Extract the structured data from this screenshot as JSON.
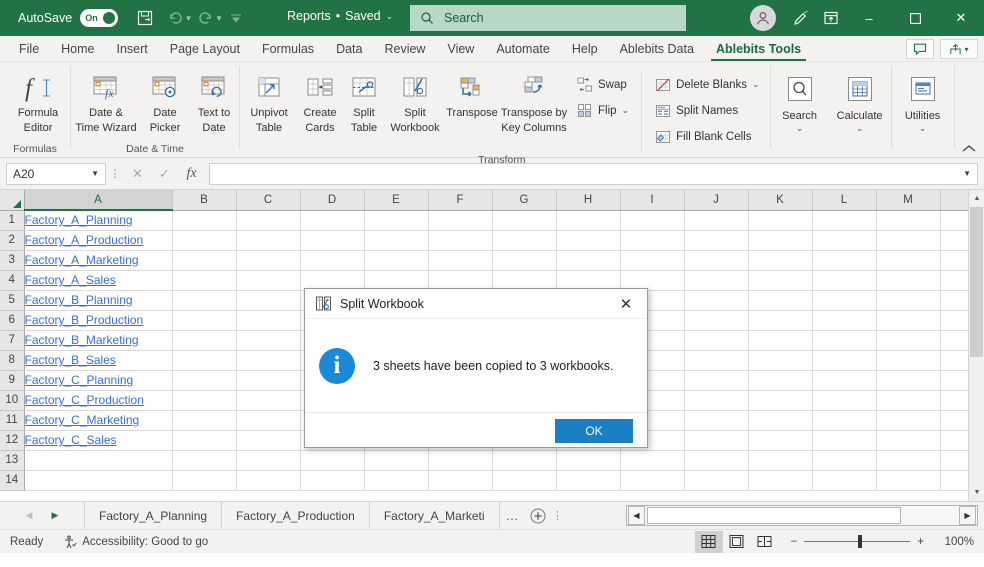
{
  "titlebar": {
    "autosave_label": "AutoSave",
    "autosave_state": "On",
    "doc_title": "Reports",
    "doc_sep": "•",
    "doc_status": "Saved",
    "search_placeholder": "Search",
    "minimize": "–",
    "maximize": "▢",
    "close": "✕",
    "accent": "#217346"
  },
  "ribbon_tabs": [
    {
      "label": "File",
      "active": false
    },
    {
      "label": "Home",
      "active": false
    },
    {
      "label": "Insert",
      "active": false
    },
    {
      "label": "Page Layout",
      "active": false
    },
    {
      "label": "Formulas",
      "active": false
    },
    {
      "label": "Data",
      "active": false
    },
    {
      "label": "Review",
      "active": false
    },
    {
      "label": "View",
      "active": false
    },
    {
      "label": "Automate",
      "active": false
    },
    {
      "label": "Help",
      "active": false
    },
    {
      "label": "Ablebits Data",
      "active": false
    },
    {
      "label": "Ablebits Tools",
      "active": true
    }
  ],
  "ribbon": {
    "groups": [
      {
        "label": "Formulas",
        "buttons": [
          {
            "label_line1": "Formula",
            "label_line2": "Editor",
            "icon": "formula-editor-icon"
          }
        ]
      },
      {
        "label": "Date & Time",
        "buttons": [
          {
            "label_line1": "Date &",
            "label_line2": "Time Wizard",
            "icon": "date-time-wizard-icon"
          },
          {
            "label_line1": "Date",
            "label_line2": "Picker",
            "icon": "date-picker-icon"
          },
          {
            "label_line1": "Text to",
            "label_line2": "Date",
            "icon": "text-to-date-icon"
          }
        ]
      },
      {
        "label": "Transform",
        "buttons": [
          {
            "label_line1": "Unpivot",
            "label_line2": "Table",
            "icon": "unpivot-table-icon"
          },
          {
            "label_line1": "Create",
            "label_line2": "Cards",
            "icon": "create-cards-icon"
          },
          {
            "label_line1": "Split",
            "label_line2": "Table",
            "icon": "split-table-icon"
          },
          {
            "label_line1": "Split",
            "label_line2": "Workbook",
            "icon": "split-workbook-icon"
          },
          {
            "label_line1": "Transpose",
            "label_line2": "",
            "icon": "transpose-icon"
          },
          {
            "label_line1": "Transpose by",
            "label_line2": "Key Columns",
            "icon": "transpose-by-key-columns-icon"
          }
        ],
        "small_buttons_1": [
          {
            "label": "Swap",
            "icon": "swap-icon",
            "has_caret": false
          },
          {
            "label": "Flip",
            "icon": "flip-icon",
            "has_caret": true
          }
        ],
        "small_buttons_2": [
          {
            "label": "Delete Blanks",
            "icon": "delete-blanks-icon",
            "has_caret": true
          },
          {
            "label": "Split Names",
            "icon": "split-names-icon",
            "has_caret": false
          },
          {
            "label": "Fill Blank Cells",
            "icon": "fill-blank-cells-icon",
            "has_caret": false
          }
        ]
      },
      {
        "label": "",
        "buttons": [
          {
            "label_line1": "Search",
            "label_line2": "",
            "icon": "search-magnifier-icon",
            "has_caret": true
          },
          {
            "label_line1": "Calculate",
            "label_line2": "",
            "icon": "calculate-icon",
            "has_caret": true
          }
        ]
      },
      {
        "label": "",
        "buttons": [
          {
            "label_line1": "Utilities",
            "label_line2": "",
            "icon": "utilities-icon",
            "has_caret": true
          }
        ]
      }
    ],
    "collapse_icon": "chevron-up-icon"
  },
  "formula_bar": {
    "name_box_value": "A20",
    "cancel_icon": "cancel-icon",
    "enter_icon": "check-icon",
    "fx_icon": "fx-icon",
    "formula_value": ""
  },
  "grid": {
    "columns": [
      "A",
      "B",
      "C",
      "D",
      "E",
      "F",
      "G",
      "H",
      "I",
      "J",
      "K",
      "L",
      "M"
    ],
    "selected_column": "A",
    "rows": [
      1,
      2,
      3,
      4,
      5,
      6,
      7,
      8,
      9,
      10,
      11,
      12,
      13,
      14
    ],
    "column_a_values": [
      "Factory_A_Planning",
      "Factory_A_Production",
      "Factory_A_Marketing",
      "Factory_A_Sales",
      "Factory_B_Planning",
      "Factory_B_Production",
      "Factory_B_Marketing",
      "Factory_B_Sales",
      "Factory_C_Planning",
      "Factory_C_Production",
      "Factory_C_Marketing",
      "Factory_C_Sales",
      "",
      ""
    ]
  },
  "dialog": {
    "title": "Split Workbook",
    "title_icon": "split-workbook-dialog-icon",
    "close_label": "✕",
    "info_icon": "info-icon",
    "info_glyph": "i",
    "message": "3 sheets have been copied to 3 workbooks.",
    "ok_label": "OK",
    "button_color": "#1b7fc4"
  },
  "sheet_tabs": {
    "first_arrow": "◀",
    "next_arrow": "▶",
    "tabs": [
      {
        "label": "Factory_A_Planning"
      },
      {
        "label": "Factory_A_Production"
      },
      {
        "label": "Factory_A_Marketi"
      }
    ],
    "overflow": "…",
    "add_label": "+",
    "menu_dots": "⋮"
  },
  "status_bar": {
    "ready": "Ready",
    "accessibility_icon": "accessibility-icon",
    "accessibility": "Accessibility: Good to go",
    "views": [
      {
        "name": "normal-view",
        "active": true
      },
      {
        "name": "page-layout-view",
        "active": false
      },
      {
        "name": "page-break-view",
        "active": false
      }
    ],
    "zoom_out": "−",
    "zoom_in": "+",
    "zoom_level": "100%"
  }
}
